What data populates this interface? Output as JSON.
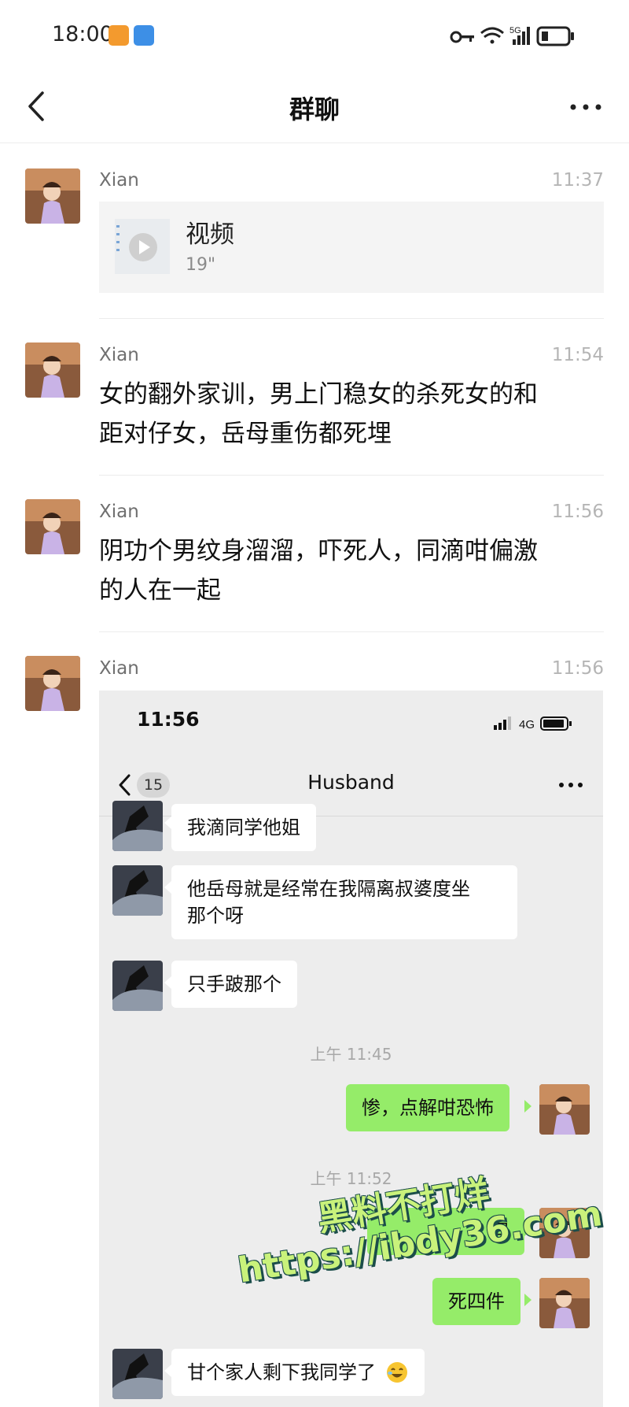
{
  "status_bar": {
    "time": "18:00",
    "network": "5G",
    "icons": [
      "app-notification-icon",
      "app-notification-icon",
      "key-icon",
      "wifi-icon",
      "signal-icon",
      "battery-icon"
    ]
  },
  "nav": {
    "title": "群聊",
    "back_icon": "chevron-left-icon",
    "more_icon": "more-icon"
  },
  "messages": [
    {
      "sender": "Xian",
      "time": "11:37",
      "type": "video",
      "video_title": "视频",
      "duration": "19\""
    },
    {
      "sender": "Xian",
      "time": "11:54",
      "type": "text",
      "lines": [
        "女的翻外家训，男上门稳女的杀死女的和",
        "距对仔女，岳母重伤都死埋"
      ]
    },
    {
      "sender": "Xian",
      "time": "11:56",
      "type": "text",
      "lines": [
        "阴功个男纹身溜溜，吓死人，同滴咁偏激",
        "的人在一起"
      ]
    },
    {
      "sender": "Xian",
      "time": "11:56",
      "type": "image"
    }
  ],
  "screenshot": {
    "status_time": "11:56",
    "network": "4G",
    "title": "Husband",
    "unread_badge": "15",
    "bubbles": [
      {
        "side": "left",
        "lines": [
          "我滴同学他姐"
        ]
      },
      {
        "side": "left",
        "lines": [
          "他岳母就是经常在我隔离叔婆度坐",
          "那个呀"
        ]
      },
      {
        "side": "left",
        "lines": [
          "只手跛那个"
        ]
      },
      {
        "side": "right",
        "lines": [
          "惨，点解咁恐怖"
        ]
      },
      {
        "side": "right",
        "lines": [
          "埋"
        ]
      },
      {
        "side": "right",
        "lines": [
          "死四件"
        ]
      },
      {
        "side": "left",
        "lines": [
          "甘个家人剩下我同学了"
        ]
      }
    ],
    "timestamps": [
      "上午 11:45",
      "上午 11:52"
    ]
  },
  "watermark": {
    "line1": "黑料不打烊",
    "line2": "https://ibdy36.com"
  },
  "colors": {
    "accent_green": "#95ec69",
    "chat_bg": "#ededed",
    "watermark_fill": "#c9f27b"
  }
}
